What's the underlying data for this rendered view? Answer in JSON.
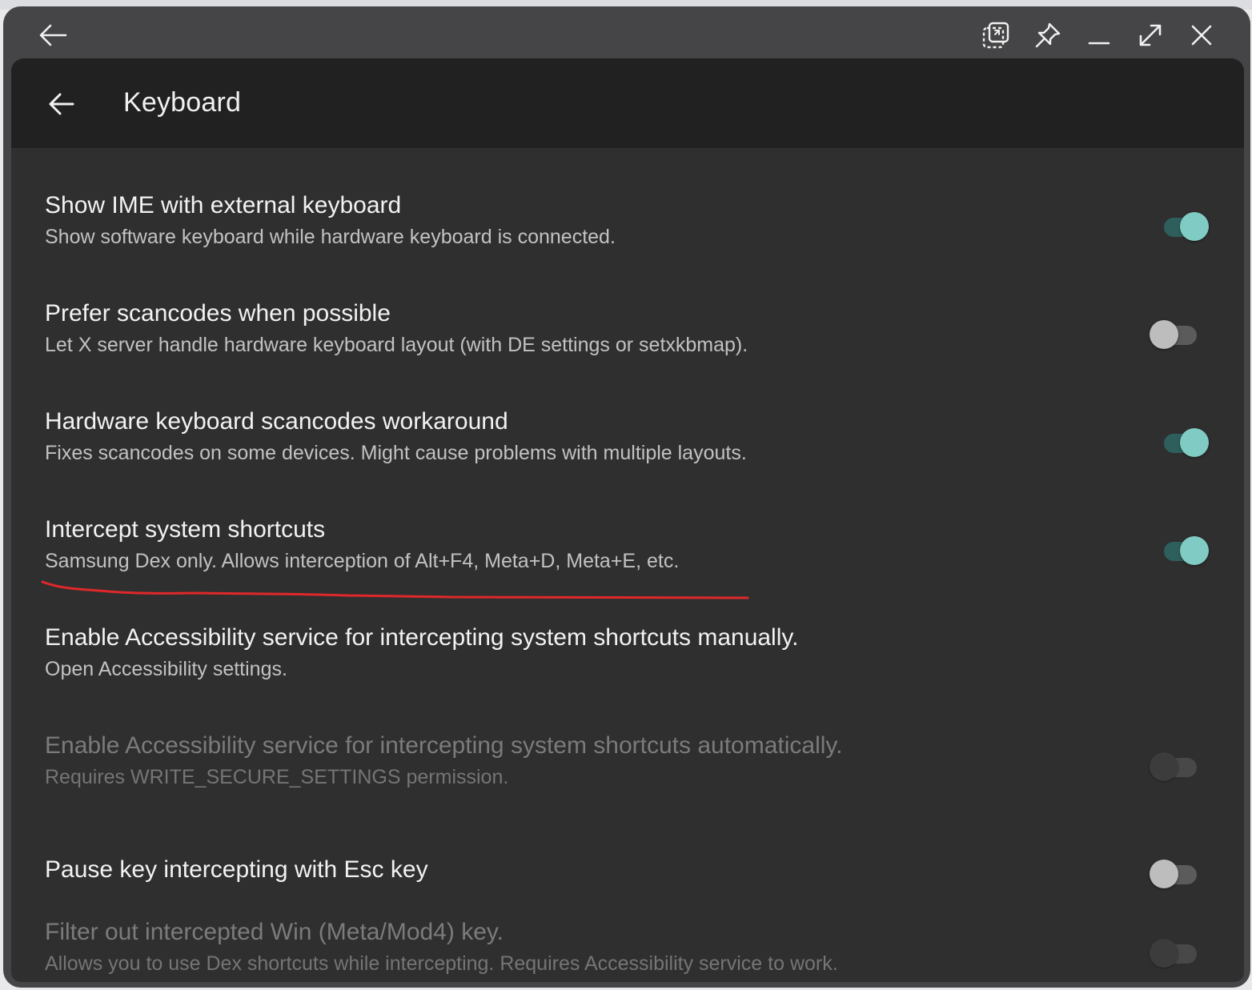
{
  "window": {
    "controls": [
      "back-icon",
      "screenshot-icon",
      "pin-icon",
      "minimize-icon",
      "maximize-icon",
      "close-icon"
    ]
  },
  "appbar": {
    "title": "Keyboard",
    "back_icon": "arrow-left-icon"
  },
  "colors": {
    "switch_on_thumb": "#80cbc4",
    "switch_on_track": "#2f5f5c",
    "switch_off_thumb": "#bdbdbd",
    "annotation": "#e0282a"
  },
  "preferences": [
    {
      "title": "Show IME with external keyboard",
      "summary": "Show software keyboard while hardware keyboard is connected.",
      "switch": "on",
      "enabled": true
    },
    {
      "title": "Prefer scancodes when possible",
      "summary": "Let X server handle hardware keyboard layout (with DE settings or setxkbmap).",
      "switch": "off",
      "enabled": true
    },
    {
      "title": "Hardware keyboard scancodes workaround",
      "summary": "Fixes scancodes on some devices. Might cause problems with multiple layouts.",
      "switch": "on",
      "enabled": true
    },
    {
      "title": "Intercept system shortcuts",
      "summary": "Samsung Dex only. Allows interception of Alt+F4, Meta+D, Meta+E, etc.",
      "switch": "on",
      "enabled": true
    },
    {
      "title": "Enable Accessibility service for intercepting system shortcuts manually.",
      "summary": "Open Accessibility settings.",
      "enabled": true
    },
    {
      "title": "Enable Accessibility service for intercepting system shortcuts automatically.",
      "summary": "Requires WRITE_SECURE_SETTINGS permission.",
      "switch": "off",
      "enabled": false
    },
    {
      "title": "Pause key intercepting with Esc key",
      "switch": "off",
      "enabled": true
    },
    {
      "title": "Filter out intercepted Win (Meta/Mod4) key.",
      "summary": "Allows you to use Dex shortcuts while intercepting. Requires Accessibility service to work.",
      "switch": "off",
      "enabled": false
    }
  ]
}
